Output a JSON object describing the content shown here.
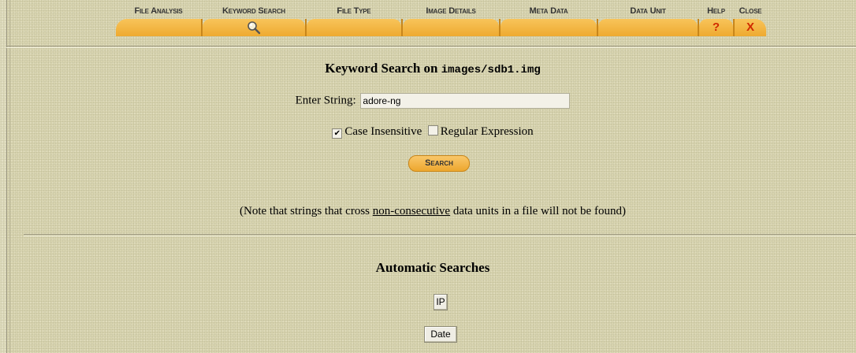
{
  "nav": {
    "tabs": [
      {
        "label": "File Analysis"
      },
      {
        "label": "Keyword Search"
      },
      {
        "label": "File Type"
      },
      {
        "label": "Image Details"
      },
      {
        "label": "Meta Data"
      },
      {
        "label": "Data Unit"
      },
      {
        "label": "Help",
        "glyph": "?"
      },
      {
        "label": "Close",
        "glyph": "X"
      }
    ],
    "active_tab": "Keyword Search"
  },
  "search": {
    "title_prefix": "Keyword Search on",
    "image_path": "images/sdb1.img",
    "enter_label": "Enter String:",
    "value": "adore-ng",
    "case_insensitive_label": "Case Insensitive",
    "case_insensitive_checked": true,
    "regex_label": "Regular Expression",
    "regex_checked": false,
    "button_label": "Search"
  },
  "note": {
    "before": "(Note that strings that cross ",
    "underlined": "non-consecutive",
    "after": " data units in a file will not be found)"
  },
  "automatic": {
    "title": "Automatic Searches",
    "buttons": [
      "IP",
      "Date"
    ]
  },
  "colors": {
    "background": "#d8d4b0",
    "tab_orange": "#f0ae36",
    "tab_glyph_red": "#d02a00"
  }
}
